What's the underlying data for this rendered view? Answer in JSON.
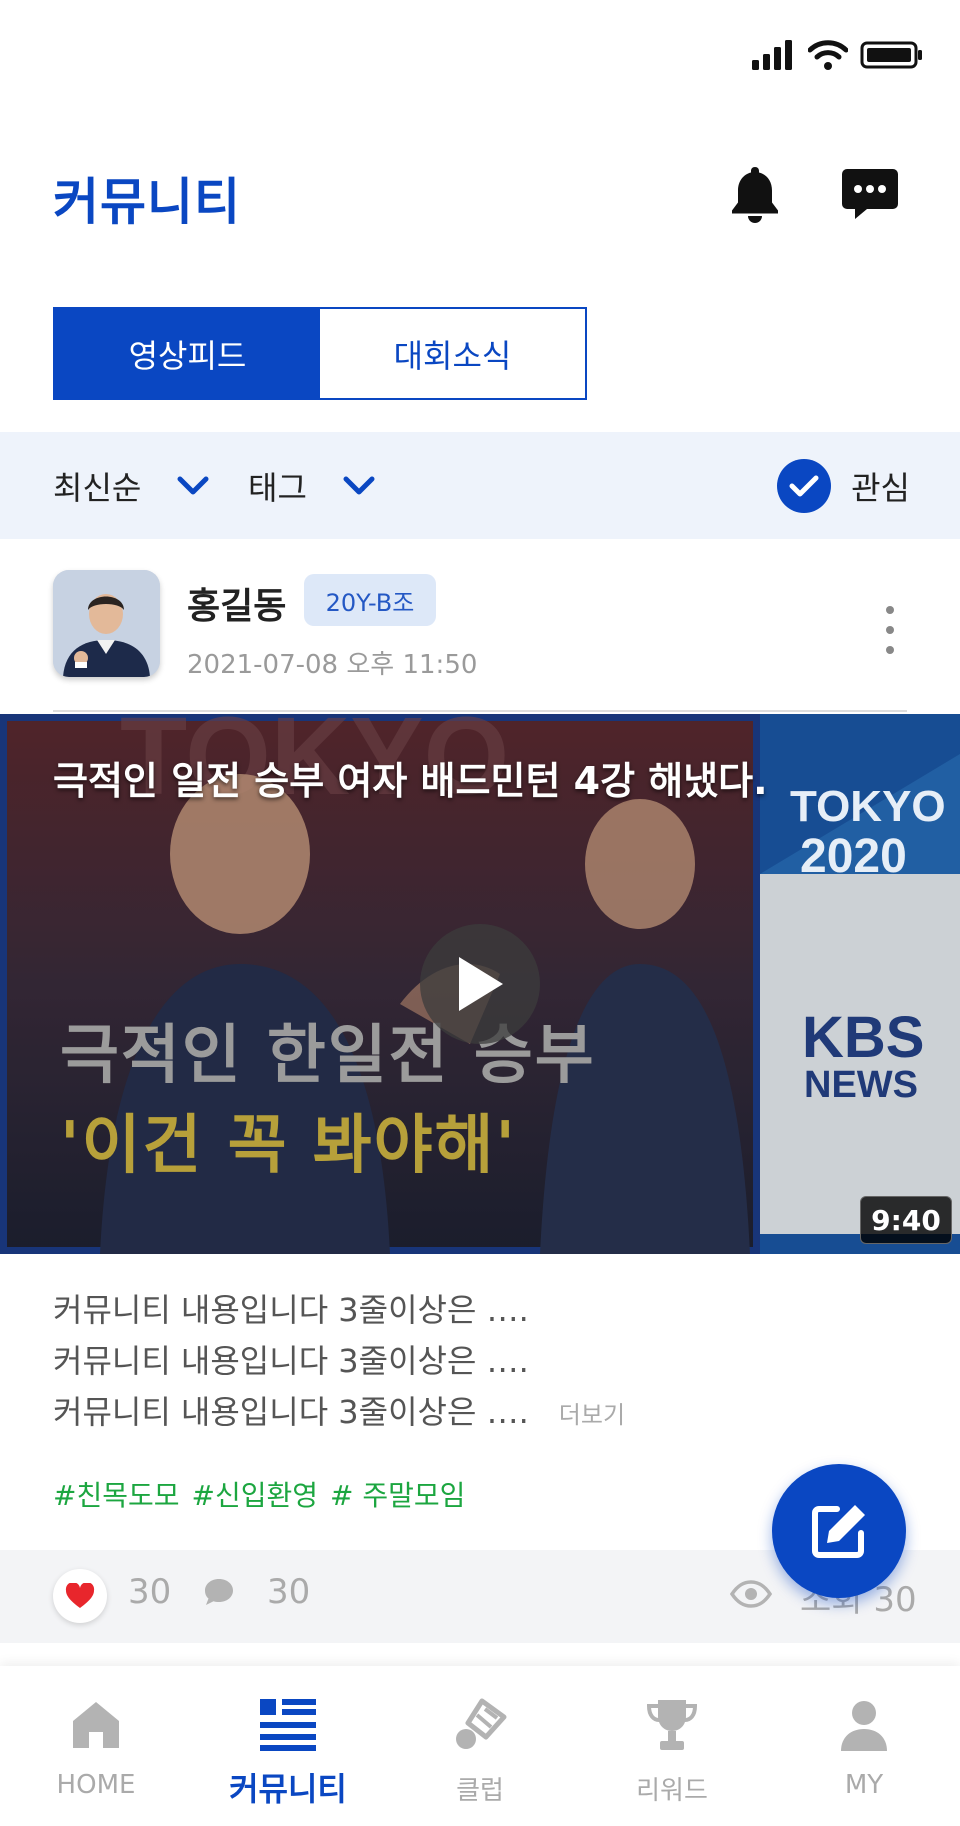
{
  "header": {
    "title": "커뮤니티",
    "notification_icon": "bell-icon",
    "message_icon": "chat-bubble-icon"
  },
  "tabs": [
    {
      "label": "영상피드",
      "active": true
    },
    {
      "label": "대회소식",
      "active": false
    }
  ],
  "filters": {
    "sort_label": "최신순",
    "tag_label": "태그",
    "interest_label": "관심",
    "interest_checked": true
  },
  "post": {
    "author": "홍길동",
    "badge": "20Y-B조",
    "date": "2021-07-08 오후 11:50",
    "video": {
      "title": "극적인 일전 승부 여자 배드민턴 4강 해냈다.",
      "thumb_line1": "극적인 한일전 승부",
      "thumb_line2": "'이건 꼭 봐야해'",
      "brand_top": "TOKYO",
      "brand_year": "2020",
      "brand_kbs": "KBS",
      "brand_news": "NEWS",
      "duration": "9:40"
    },
    "content_lines": [
      "커뮤니티 내용입니다 3줄이상은 ….",
      "커뮤니티 내용입니다 3줄이상은 ….",
      "커뮤니티 내용입니다 3줄이상은 …."
    ],
    "read_more": "더보기",
    "tags": [
      "#친목도모",
      "#신입환영",
      "# 주말모임"
    ],
    "likes": "30",
    "comments": "30",
    "views": "조회 30"
  },
  "nav": [
    {
      "label": "HOME",
      "icon": "home-icon",
      "active": false
    },
    {
      "label": "커뮤니티",
      "icon": "list-icon",
      "active": true
    },
    {
      "label": "클럽",
      "icon": "shuttlecock-icon",
      "active": false
    },
    {
      "label": "리워드",
      "icon": "trophy-icon",
      "active": false
    },
    {
      "label": "MY",
      "icon": "person-icon",
      "active": false
    }
  ],
  "colors": {
    "brand": "#0a47c2",
    "tag_green": "#1ca640",
    "heart_red": "#e8262c"
  }
}
